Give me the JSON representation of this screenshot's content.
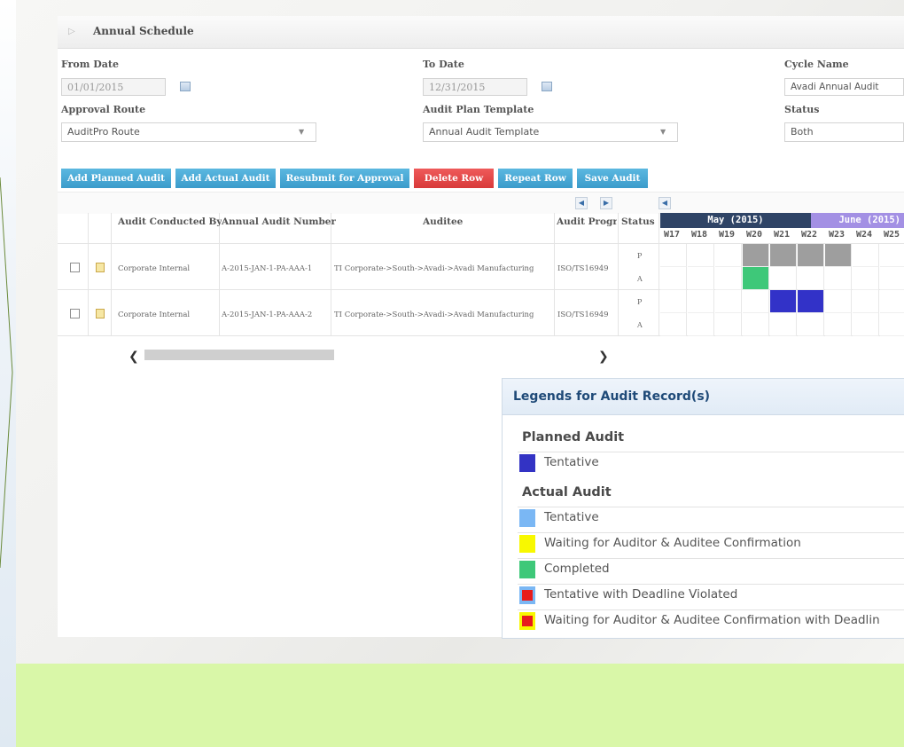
{
  "panel": {
    "title": "Annual Schedule"
  },
  "form": {
    "from_date": {
      "label": "From Date",
      "value": "01/01/2015"
    },
    "to_date": {
      "label": "To Date",
      "value": "12/31/2015"
    },
    "cycle_name": {
      "label": "Cycle Name",
      "value": "Avadi Annual Audit"
    },
    "approval_route": {
      "label": "Approval Route",
      "value": "AuditPro Route"
    },
    "audit_plan_template": {
      "label": "Audit Plan Template",
      "value": "Annual Audit Template"
    },
    "status": {
      "label": "Status",
      "value": "Both"
    }
  },
  "toolbar": {
    "add_planned": "Add Planned Audit",
    "add_actual": "Add Actual Audit",
    "resubmit": "Resubmit for Approval",
    "delete_row": "Delete Row",
    "repeat_row": "Repeat Row",
    "save_audit": "Save Audit"
  },
  "grid": {
    "headers": {
      "conducted_by": "Audit Conducted By",
      "number": "Annual Audit Number",
      "auditee": "Auditee",
      "program": "Audit Progra",
      "status": "Status"
    },
    "months": [
      "May (2015)",
      "June (2015)"
    ],
    "weeks": [
      "W17",
      "W18",
      "W19",
      "W20",
      "W21",
      "W22",
      "W23",
      "W24",
      "W25"
    ],
    "rows": [
      {
        "conducted_by": "Corporate Internal",
        "number": "A-2015-JAN-1-PA-AAA-1",
        "auditee": "TI Corporate->South->Avadi->Avadi Manufacturing",
        "program": "ISO/TS16949",
        "status_p": "P",
        "status_a": "A",
        "planned_weeks": [
          "W20",
          "W21",
          "W22",
          "W23"
        ],
        "planned_color": "#9e9e9e",
        "actual_weeks": [
          "W20"
        ],
        "actual_color": "#3ec879"
      },
      {
        "conducted_by": "Corporate Internal",
        "number": "A-2015-JAN-1-PA-AAA-2",
        "auditee": "TI Corporate->South->Avadi->Avadi Manufacturing",
        "program": "ISO/TS16949",
        "status_p": "P",
        "status_a": "A",
        "planned_weeks": [
          "W21",
          "W22"
        ],
        "planned_color": "#3232c8",
        "actual_weeks": [],
        "actual_color": ""
      }
    ]
  },
  "legend": {
    "title": "Legends for Audit Record(s)",
    "planned_heading": "Planned Audit",
    "planned": [
      {
        "label": "Tentative",
        "color": "#3333c4"
      }
    ],
    "actual_heading": "Actual Audit",
    "actual": [
      {
        "label": "Tentative",
        "color": "#7ab7f4"
      },
      {
        "label": "Waiting for Auditor & Auditee Confirmation",
        "color": "#f8f800"
      },
      {
        "label": "Completed",
        "color": "#3ec879"
      },
      {
        "label": "Tentative with Deadline Violated",
        "color": "#7ab7f4",
        "inner": "#e81c1c"
      },
      {
        "label": "Waiting for Auditor & Auditee Confirmation with Deadlin",
        "color": "#f8f800",
        "inner": "#e81c1c"
      }
    ]
  }
}
